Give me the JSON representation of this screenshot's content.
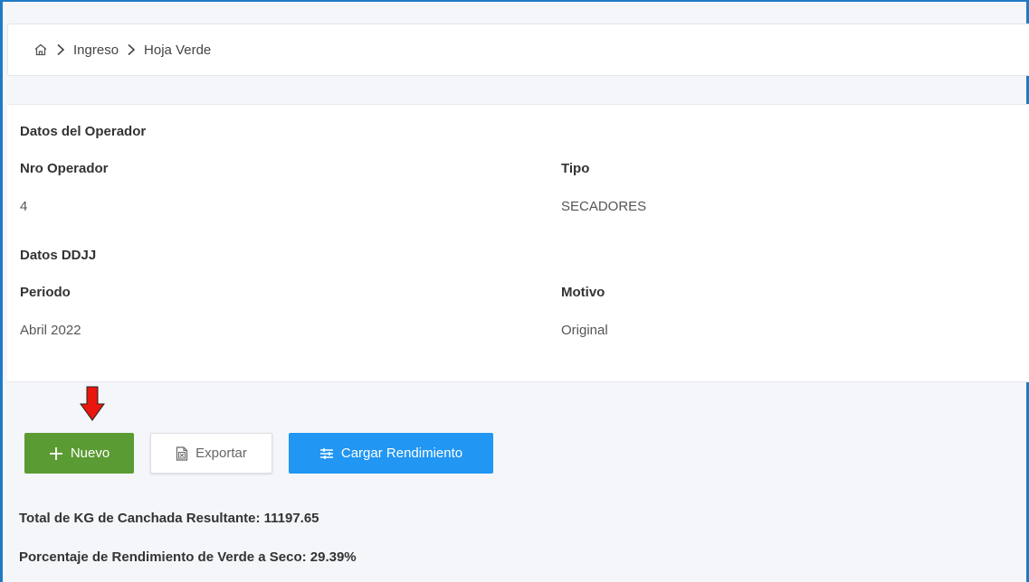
{
  "breadcrumb": {
    "items": [
      "Ingreso",
      "Hoja Verde"
    ]
  },
  "operador": {
    "section_title": "Datos del Operador",
    "nro_label": "Nro Operador",
    "nro_value": "4",
    "tipo_label": "Tipo",
    "tipo_value": "SECADORES"
  },
  "ddjj": {
    "section_title": "Datos DDJJ",
    "periodo_label": "Periodo",
    "periodo_value": "Abril 2022",
    "motivo_label": "Motivo",
    "motivo_value": "Original"
  },
  "toolbar": {
    "nuevo_label": "Nuevo",
    "exportar_label": "Exportar",
    "cargar_label": "Cargar Rendimiento"
  },
  "summary": {
    "total_kg": "Total de KG de Canchada Resultante: 11197.65",
    "porcentaje": "Porcentaje de Rendimiento de Verde a Seco: 29.39%"
  },
  "colors": {
    "accent_green": "#5b9b33",
    "accent_blue": "#2196f3",
    "arrow_red": "#e8160c"
  },
  "icons": [
    "home-icon",
    "chevron-right-icon",
    "plus-icon",
    "excel-file-icon",
    "sliders-icon",
    "red-down-arrow-icon"
  ]
}
